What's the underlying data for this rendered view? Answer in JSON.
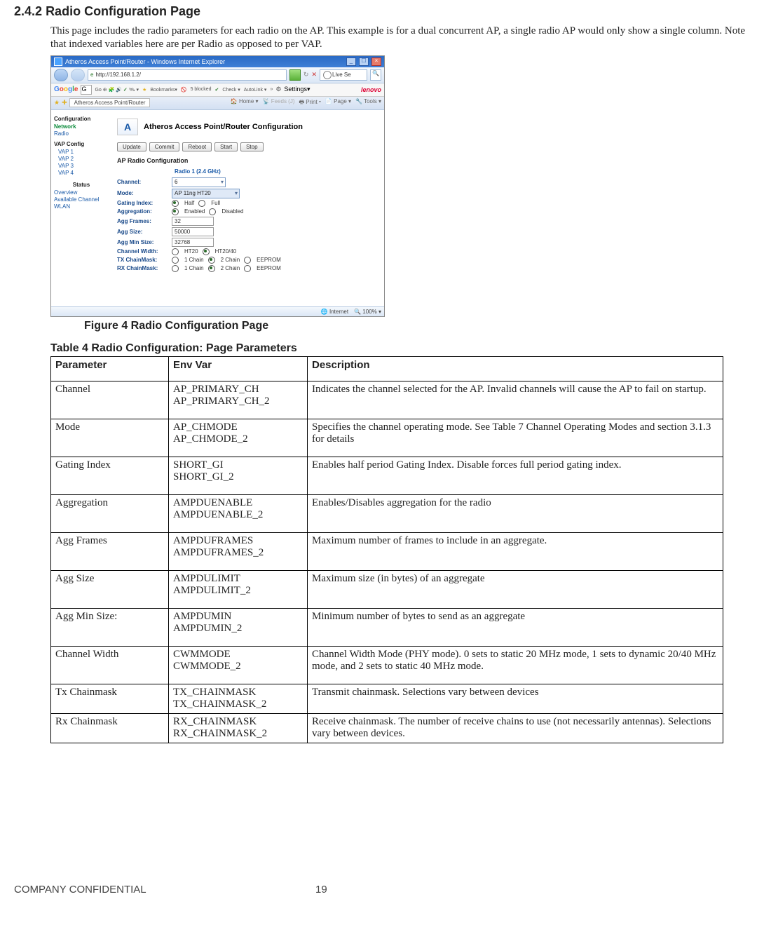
{
  "section_number": "2.4.2",
  "section_title": "Radio Configuration Page",
  "intro_paragraph": "This page includes the radio parameters for each radio on the AP. This example is for a dual concurrent AP, a single radio AP would only show a single column. Note that indexed variables here are per Radio as opposed to per VAP.",
  "figure_caption": "Figure 4 Radio Configuration Page",
  "table_title": "Table 4 Radio Configuration: Page Parameters",
  "table_headers": {
    "p": "Parameter",
    "e": "Env Var",
    "d": "Description"
  },
  "rows": [
    {
      "p": "Channel",
      "e": "AP_PRIMARY_CH\nAP_PRIMARY_CH_2",
      "d": "Indicates the channel selected for the AP. Invalid channels will cause the AP to fail on startup."
    },
    {
      "p": "Mode",
      "e": "AP_CHMODE\nAP_CHMODE_2",
      "d": "Specifies the channel operating mode. See Table 7 Channel Operating Modes and section 3.1.3 for details",
      "special": true
    },
    {
      "p": "Gating Index",
      "e": "SHORT_GI\nSHORT_GI_2",
      "d": "Enables half period Gating Index. Disable forces full period gating index."
    },
    {
      "p": "Aggregation",
      "e": "AMPDUENABLE\nAMPDUENABLE_2",
      "d": "Enables/Disables aggregation for the radio"
    },
    {
      "p": "Agg Frames",
      "e": "AMPDUFRAMES\nAMPDUFRAMES_2",
      "d": "Maximum number of frames to include in an aggregate."
    },
    {
      "p": "Agg Size",
      "e": "AMPDULIMIT\nAMPDULIMIT_2",
      "d": "Maximum size (in bytes) of an aggregate"
    },
    {
      "p": "Agg Min Size:",
      "e": "AMPDUMIN\nAMPDUMIN_2",
      "d": "Minimum number of bytes to send as an aggregate"
    },
    {
      "p": "Channel Width",
      "e": "CWMMODE\nCWMMODE_2",
      "d": "Channel Width Mode (PHY mode). 0 sets to static 20 MHz mode, 1 sets to dynamic 20/40 MHz mode, and 2 sets to static 40 MHz mode."
    },
    {
      "p": "Tx Chainmask",
      "e": "TX_CHAINMASK\nTX_CHAINMASK_2",
      "d": "Transmit chainmask. Selections vary between devices",
      "tight": true
    },
    {
      "p": "Rx Chainmask",
      "e": "RX_CHAINMASK\nRX_CHAINMASK_2",
      "d": "Receive chainmask. The number of receive chains to use (not necessarily antennas). Selections vary between devices.",
      "tight": true
    }
  ],
  "mode_desc_parts": {
    "a": "Specifies the channel operating mode. See Table 7 ",
    "b": "Channel Operating Modes",
    "c": " and section 3.1.3 for details"
  },
  "footer_left": "COMPANY CONFIDENTIAL",
  "footer_page": "19",
  "browser": {
    "window_title": "Atheros Access Point/Router - Windows Internet Explorer",
    "url": "http://192.168.1.2/",
    "search_engine": "Live Se",
    "google_prefix": "G",
    "google_toolbar": {
      "go": "Go",
      "bookmarks": "Bookmarks▾",
      "blocked": "5 blocked",
      "check": "Check ▾",
      "autolink": "AutoLink ▾",
      "more": "»",
      "settings": "Settings▾",
      "brand": "lenovo"
    },
    "tab_title": "Atheros Access Point/Router",
    "tabbar_right": {
      "home": "Home  ▾",
      "feeds": "Feeds (J)",
      "print": "Print  ▾",
      "page": "Page ▾",
      "tools": "Tools ▾"
    },
    "brand_heading": "Atheros Access Point/Router Configuration",
    "sidebar": {
      "configuration": "Configuration",
      "network": "Network",
      "radio": "Radio",
      "vap_config": "VAP Config",
      "vap1": "VAP 1",
      "vap2": "VAP 2",
      "vap3": "VAP 3",
      "vap4": "VAP 4",
      "status": "Status",
      "overview": "Overview",
      "available_channel": "Available Channel",
      "wlan": "WLAN"
    },
    "buttons": {
      "update": "Update",
      "commit": "Commit",
      "reboot": "Reboot",
      "start": "Start",
      "stop": "Stop"
    },
    "panel_heading": "AP Radio Configuration",
    "radio_col": "Radio 1 (2.4 GHz)",
    "fields": {
      "channel_l": "Channel:",
      "channel_v": "6",
      "mode_l": "Mode:",
      "mode_v": "AP 11ng HT20",
      "gating_l": "Gating Index:",
      "gating_half": "Half",
      "gating_full": "Full",
      "agg_l": "Aggregation:",
      "agg_en": "Enabled",
      "agg_dis": "Disabled",
      "aggf_l": "Agg Frames:",
      "aggf_v": "32",
      "aggs_l": "Agg Size:",
      "aggs_v": "50000",
      "aggm_l": "Agg Min Size:",
      "aggm_v": "32768",
      "cw_l": "Channel Width:",
      "cw_a": "HT20",
      "cw_b": "HT20/40",
      "txc_l": "TX ChainMask:",
      "rxc_l": "RX ChainMask:",
      "chain1": "1 Chain",
      "chain2": "2 Chain",
      "chainE": "EEPROM"
    },
    "status": {
      "internet": "Internet",
      "zoom": "100%  ▾"
    }
  }
}
